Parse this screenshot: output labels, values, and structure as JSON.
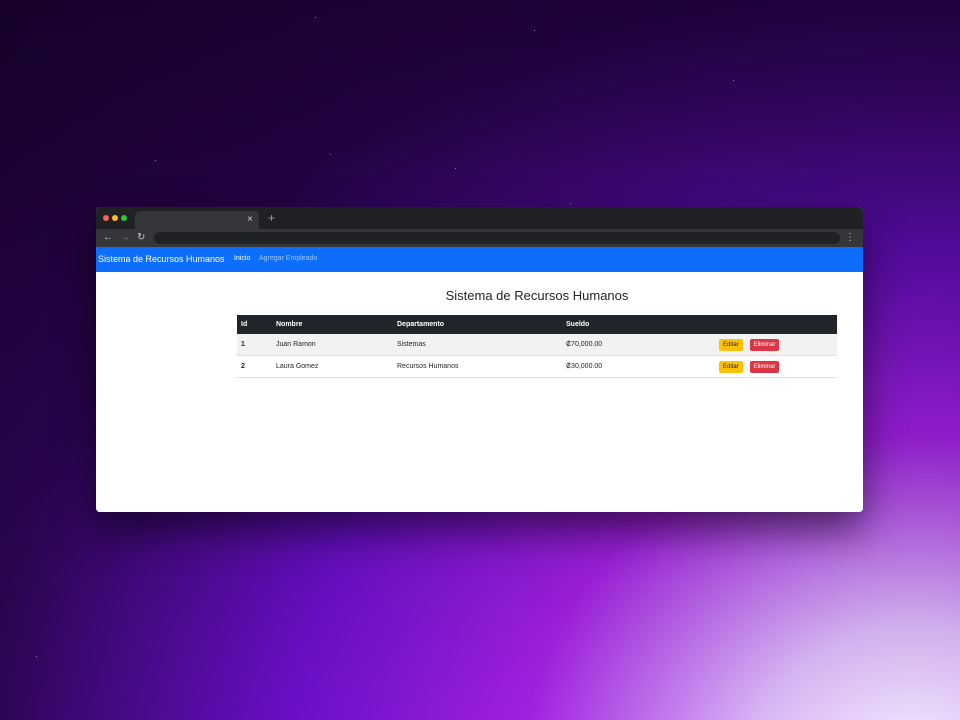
{
  "browser": {
    "close_glyph": "×",
    "new_tab_glyph": "+",
    "back_glyph": "←",
    "forward_glyph": "→",
    "reload_glyph": "↻",
    "menu_glyph": "⋮"
  },
  "navbar": {
    "brand": "Sistema de Recursos Humanos",
    "links": [
      {
        "label": "Inicio"
      },
      {
        "label": "Agregar Empleado"
      }
    ]
  },
  "main": {
    "title": "Sistema de Recursos Humanos",
    "table": {
      "headers": [
        "Id",
        "Nombre",
        "Departamento",
        "Sueldo",
        ""
      ],
      "rows": [
        {
          "id": "1",
          "nombre": "Juan Ramon",
          "departamento": "Sistemas",
          "sueldo": "₡70,000.00",
          "edit": "Editar",
          "delete": "Eliminar"
        },
        {
          "id": "2",
          "nombre": "Laura Gomez",
          "departamento": "Recursos Humanos",
          "sueldo": "₡30,000.00",
          "edit": "Editar",
          "delete": "Eliminar"
        }
      ]
    }
  },
  "colors": {
    "navbar": "#0d6efd",
    "table_header": "#212529",
    "edit_button": "#ffc107",
    "delete_button": "#dc3545"
  }
}
